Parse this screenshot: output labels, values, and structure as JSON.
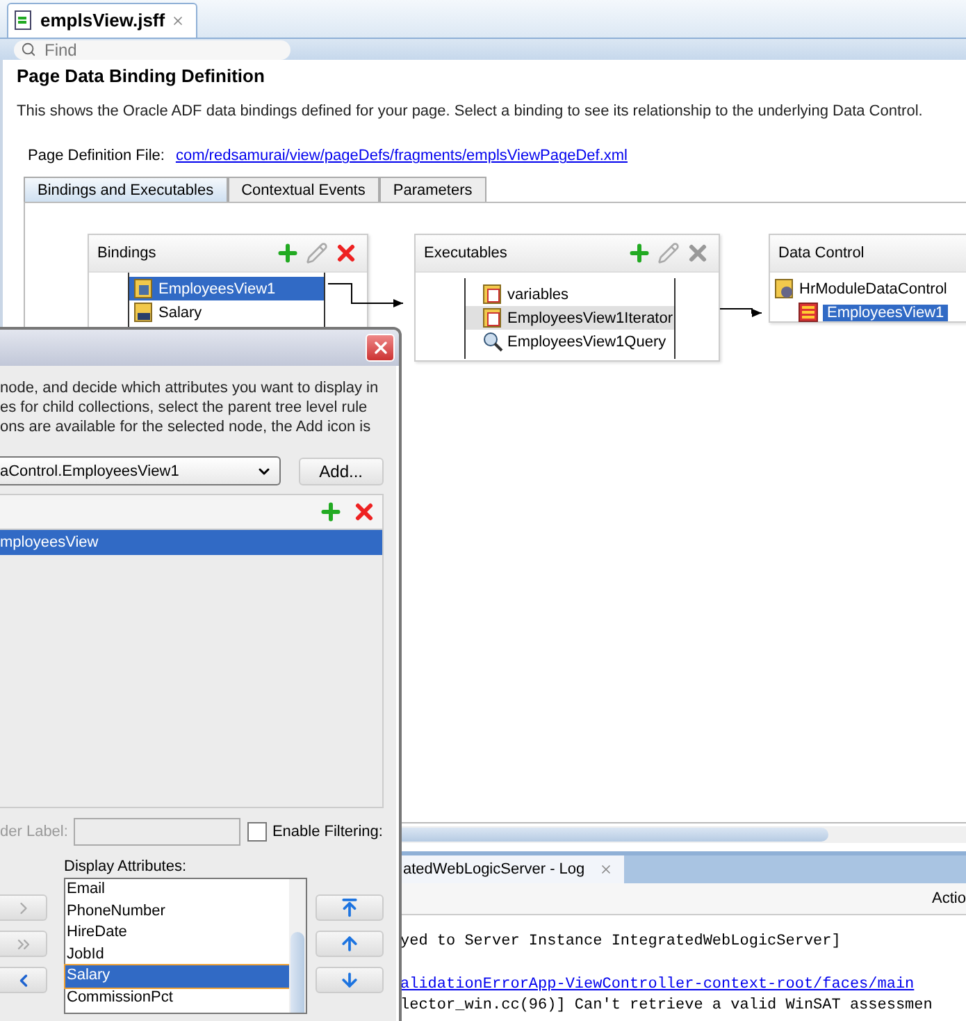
{
  "editor_tab": {
    "title": "emplsView.jsff",
    "selected": true
  },
  "find": {
    "placeholder": "Find"
  },
  "heading": "Page Data Binding Definition",
  "description": "This shows the Oracle ADF data bindings defined for your page. Select a binding to see its relationship to the underlying Data Control.",
  "page_definition": {
    "label": "Page Definition File:",
    "link": "com/redsamurai/view/pageDefs/fragments/emplsViewPageDef.xml"
  },
  "tabs": [
    {
      "label": "Bindings and Executables",
      "selected": true
    },
    {
      "label": "Contextual Events",
      "selected": false
    },
    {
      "label": "Parameters",
      "selected": false
    }
  ],
  "bindings": {
    "title": "Bindings",
    "delete_enabled": true,
    "items": [
      {
        "label": "EmployeesView1",
        "kind": "tree",
        "selected": true
      },
      {
        "label": "Salary",
        "kind": "attribute",
        "selected": false
      }
    ]
  },
  "executables": {
    "title": "Executables",
    "delete_enabled": false,
    "items": [
      {
        "label": "variables",
        "kind": "variables",
        "selected": false
      },
      {
        "label": "EmployeesView1Iterator",
        "kind": "iterator",
        "selected": true
      },
      {
        "label": "EmployeesView1Query",
        "kind": "query",
        "selected": false
      }
    ]
  },
  "data_control": {
    "title": "Data Control",
    "root": "HrModuleDataControl",
    "children": [
      {
        "label": "EmployeesView1",
        "selected": true
      }
    ]
  },
  "log": {
    "tab": "atedWebLogicServer - Log",
    "action": "Actio",
    "lines": [
      {
        "kind": "text",
        "text": "yed to Server Instance IntegratedWebLogicServer]"
      },
      {
        "kind": "link",
        "text": "alidationErrorApp-ViewController-context-root/faces/main"
      },
      {
        "kind": "text",
        "text": "lector_win.cc(96)] Can't retrieve a valid WinSAT assessmen"
      }
    ]
  },
  "dialog": {
    "description_lines": [
      "node, and decide which attributes you want to display in",
      "es for child collections, select the parent tree level rule",
      "ons are available for the selected node, the Add icon is"
    ],
    "dropdown_value": "aControl.EmployeesView1",
    "add_button": "Add...",
    "tree_items": [
      {
        "label": "mployeesView",
        "selected": true
      }
    ],
    "folder_label": "der Label:",
    "enable_filtering": {
      "label": "Enable Filtering:",
      "checked": false
    },
    "display_attributes": {
      "label": "Display Attributes:",
      "items": [
        {
          "label": "Email",
          "selected": false
        },
        {
          "label": "PhoneNumber",
          "selected": false
        },
        {
          "label": "HireDate",
          "selected": false
        },
        {
          "label": "JobId",
          "selected": false
        },
        {
          "label": "Salary",
          "selected": true
        },
        {
          "label": "CommissionPct",
          "selected": false
        }
      ]
    },
    "shuttle_buttons": [
      {
        "kind": "move-right",
        "disabled": true
      },
      {
        "kind": "move-all-right",
        "disabled": true
      },
      {
        "kind": "move-left",
        "disabled": false
      }
    ],
    "order_buttons": [
      {
        "kind": "move-top"
      },
      {
        "kind": "move-up"
      },
      {
        "kind": "move-down"
      }
    ]
  }
}
